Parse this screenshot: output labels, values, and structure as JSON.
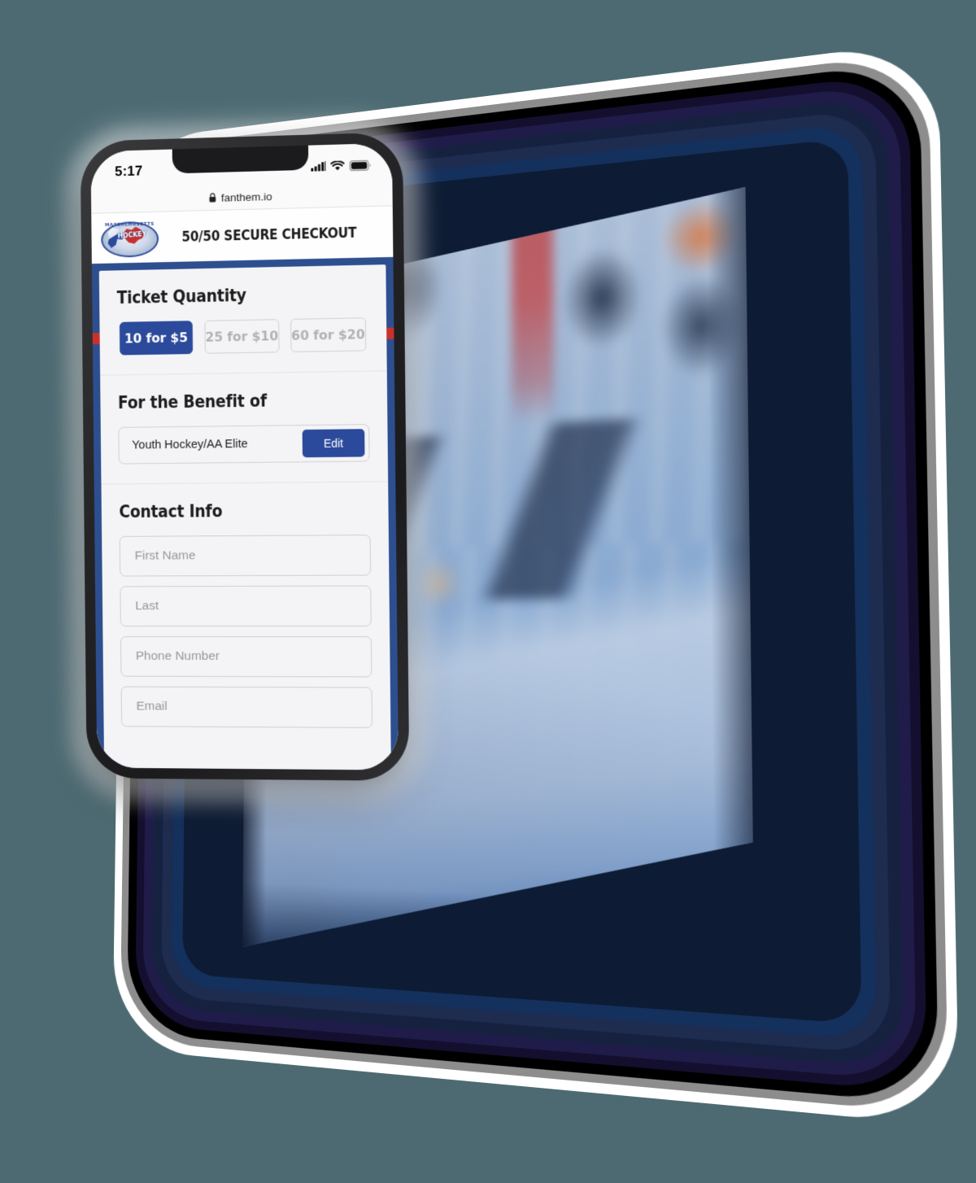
{
  "scene": {
    "background_color": "#4d6a72",
    "device_frame_color": "#14305c",
    "phone_frame_color": "#242426",
    "photo_description": "blurred retail point-of-sale checkout terminals"
  },
  "phone": {
    "status_bar": {
      "time": "5:17",
      "icons": [
        "cellular-signal-icon",
        "wifi-icon",
        "battery-icon"
      ]
    },
    "browser": {
      "lock_icon": "lock-icon",
      "url": "fanthem.io"
    },
    "site_header": {
      "logo_alt": "Massachusetts Hockey",
      "logo_arc_text": "MASSACHUSETTS",
      "logo_word": "HOCKEY",
      "title": "50/50 SECURE CHECKOUT",
      "accent_blue": "#2e4f8f",
      "accent_red": "#c9312d"
    },
    "ticket_quantity": {
      "title": "Ticket Quantity",
      "options": [
        {
          "label": "10 for $5",
          "selected": true
        },
        {
          "label": "25 for $10",
          "selected": false
        },
        {
          "label": "60 for $20",
          "selected": false
        }
      ]
    },
    "benefit": {
      "title": "For the Benefit of",
      "organization": "Youth Hockey/AA Elite",
      "edit_label": "Edit"
    },
    "contact_info": {
      "title": "Contact Info",
      "fields": [
        {
          "name": "first-name",
          "placeholder": "First Name",
          "value": ""
        },
        {
          "name": "last-name",
          "placeholder": "Last",
          "value": ""
        },
        {
          "name": "phone-number",
          "placeholder": "Phone Number",
          "value": ""
        },
        {
          "name": "email",
          "placeholder": "Email",
          "value": ""
        }
      ]
    }
  }
}
